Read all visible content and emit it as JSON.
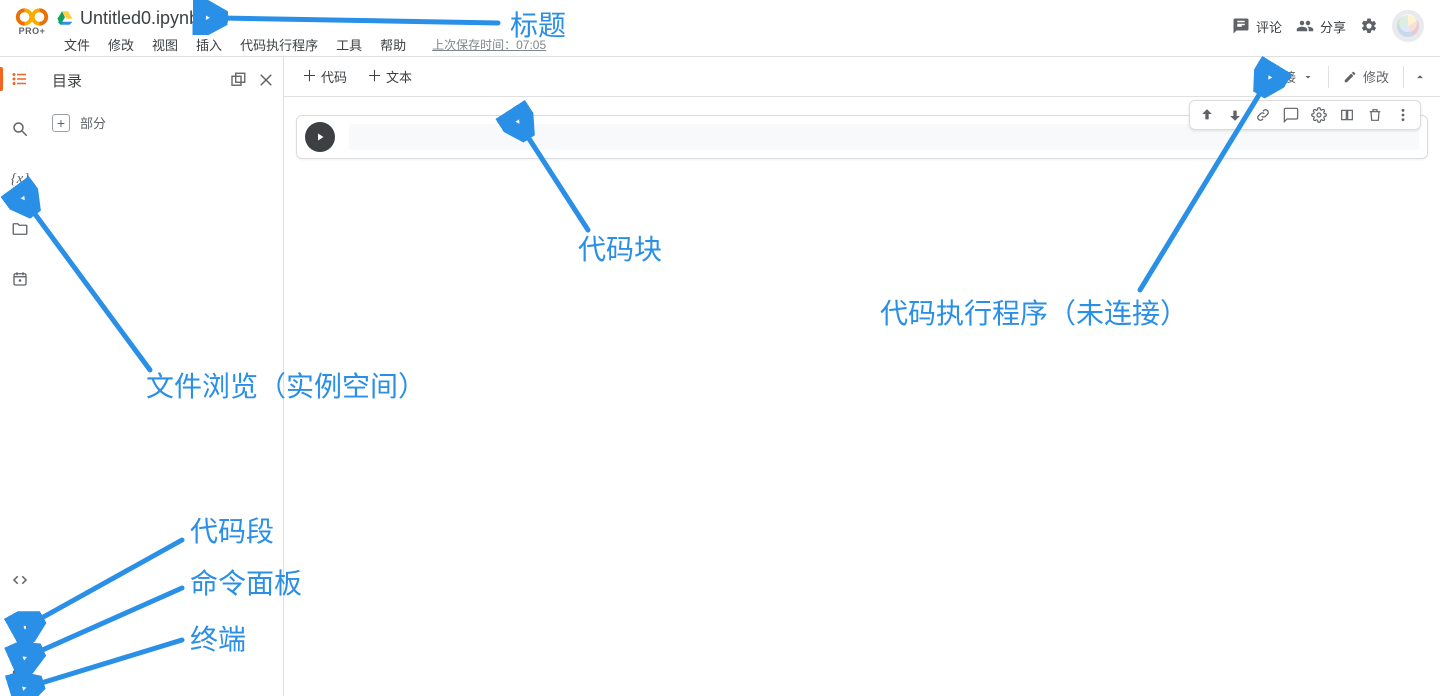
{
  "header": {
    "pro_tag": "PRO+",
    "title": "Untitled0.ipynb",
    "menus": [
      "文件",
      "修改",
      "视图",
      "插入",
      "代码执行程序",
      "工具",
      "帮助"
    ],
    "last_save": "上次保存时间：07:05",
    "comment": "评论",
    "share": "分享"
  },
  "sidebar": {
    "title": "目录",
    "add_section": "部分"
  },
  "toolbar": {
    "code": "代码",
    "text": "文本",
    "connect": "连接",
    "edit": "修改"
  },
  "cell": {
    "code_value": ""
  },
  "annotations": {
    "title": "标题",
    "code_block": "代码块",
    "runtime": "代码执行程序（未连接）",
    "file_browser": "文件浏览（实例空间）",
    "snippets": "代码段",
    "cmd_palette": "命令面板",
    "terminal": "终端"
  }
}
